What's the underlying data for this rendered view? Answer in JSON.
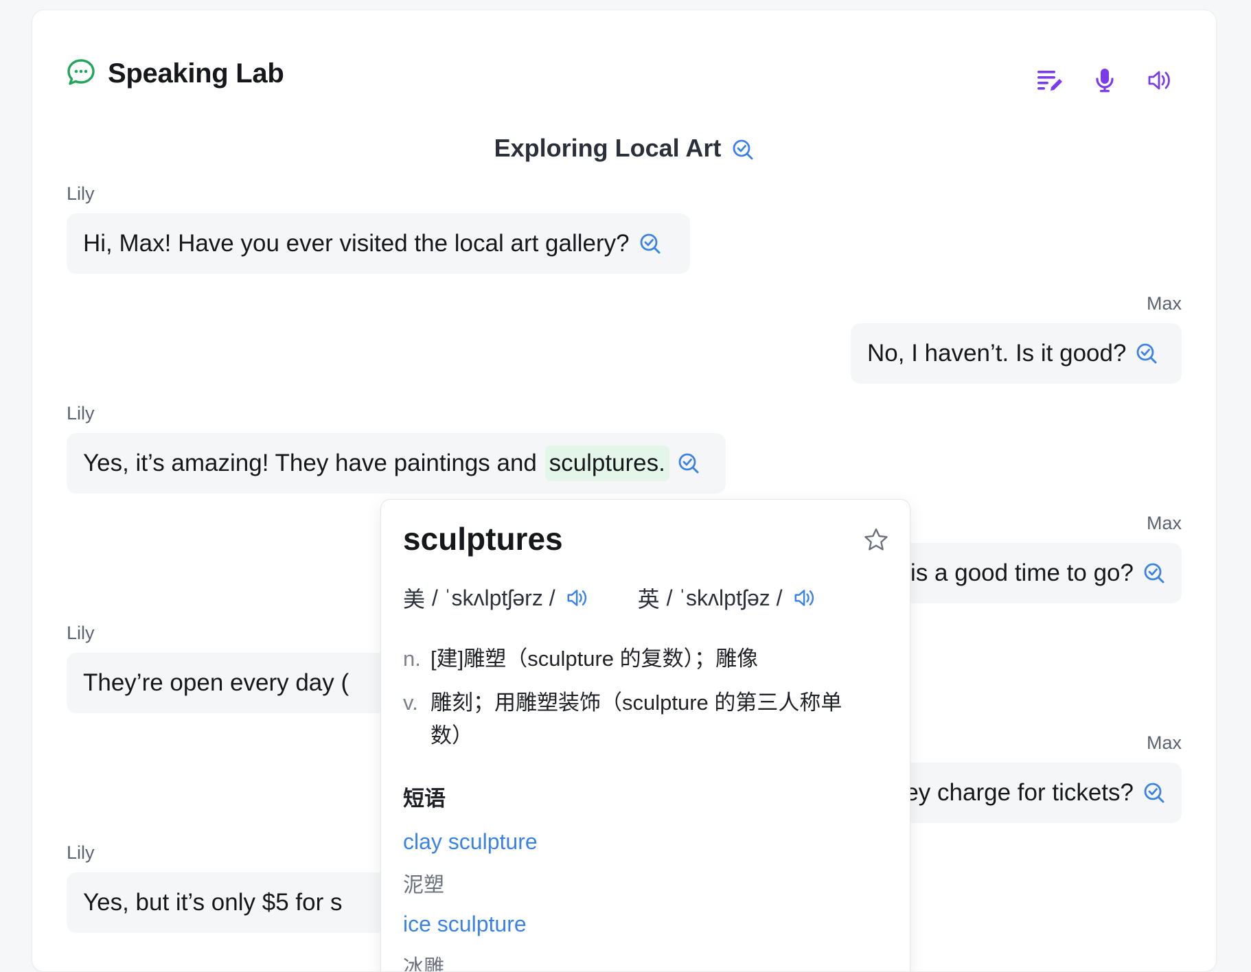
{
  "header": {
    "app_title": "Speaking Lab",
    "logo_icon": "chat-bubble-icon",
    "toolbar": [
      {
        "name": "edit-list-icon"
      },
      {
        "name": "microphone-icon"
      },
      {
        "name": "speaker-icon"
      }
    ]
  },
  "conversation": {
    "topic": "Exploring Local Art",
    "messages": [
      {
        "speaker": "Lily",
        "text": "Hi, Max! Have you ever visited the local art gallery?"
      },
      {
        "speaker": "Max",
        "text": "No, I haven’t. Is it good?"
      },
      {
        "speaker": "Lily",
        "text_before": "Yes, it’s amazing! They have paintings and ",
        "highlight": "sculptures."
      },
      {
        "speaker": "Max",
        "text": "en is a good time to go?"
      },
      {
        "speaker": "Lily",
        "text": "They’re open every day ("
      },
      {
        "speaker": "Max",
        "text": "they charge for tickets?"
      },
      {
        "speaker": "Lily",
        "text": "Yes, but it’s only $5 for s"
      }
    ]
  },
  "dictionary": {
    "word": "sculptures",
    "us_label": "美",
    "us_phonetic": "/ ˈskʌlptʃərz /",
    "uk_label": "英",
    "uk_phonetic": "/ ˈskʌlptʃəz /",
    "definitions": [
      {
        "pos": "n.",
        "text": "[建]雕塑（sculpture 的复数）；雕像"
      },
      {
        "pos": "v.",
        "text": "雕刻；用雕塑装饰（sculpture 的第三人称单数）"
      }
    ],
    "phrases_title": "短语",
    "phrases": [
      {
        "phrase": "clay sculpture",
        "translation": "泥塑"
      },
      {
        "phrase": "ice sculpture",
        "translation": "冰雕"
      }
    ]
  },
  "colors": {
    "accent_blue": "#3b82e6",
    "accent_purple": "#7c3aed",
    "logo_green": "#22a55a",
    "highlight_green": "#e4f6e9"
  }
}
